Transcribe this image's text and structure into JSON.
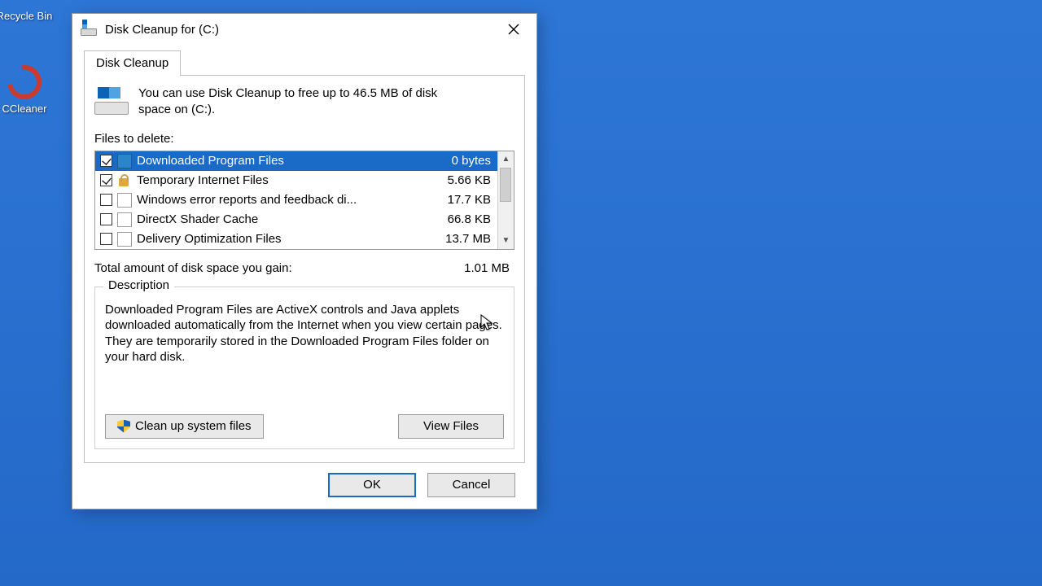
{
  "desktop": {
    "recycle_bin_label": "Recycle Bin",
    "ccleaner_label": "CCleaner"
  },
  "dialog": {
    "title": "Disk Cleanup for  (C:)",
    "tab_label": "Disk Cleanup",
    "intro_text": "You can use Disk Cleanup to free up to 46.5 MB of disk space on  (C:).",
    "files_to_delete_label": "Files to delete:",
    "total_label": "Total amount of disk space you gain:",
    "total_value": "1.01 MB",
    "description_legend": "Description",
    "description_text": "Downloaded Program Files are ActiveX controls and Java applets downloaded automatically from the Internet when you view certain pages. They are temporarily stored in the Downloaded Program Files folder on your hard disk.",
    "clean_system_label": "Clean up system files",
    "view_files_label": "View Files",
    "ok_label": "OK",
    "cancel_label": "Cancel",
    "items": [
      {
        "checked": true,
        "icon": "folder-blue",
        "name": "Downloaded Program Files",
        "size": "0 bytes",
        "selected": true
      },
      {
        "checked": true,
        "icon": "lock",
        "name": "Temporary Internet Files",
        "size": "5.66 KB",
        "selected": false
      },
      {
        "checked": false,
        "icon": "file",
        "name": "Windows error reports and feedback di...",
        "size": "17.7 KB",
        "selected": false
      },
      {
        "checked": false,
        "icon": "file",
        "name": "DirectX Shader Cache",
        "size": "66.8 KB",
        "selected": false
      },
      {
        "checked": false,
        "icon": "file",
        "name": "Delivery Optimization Files",
        "size": "13.7 MB",
        "selected": false
      }
    ]
  }
}
